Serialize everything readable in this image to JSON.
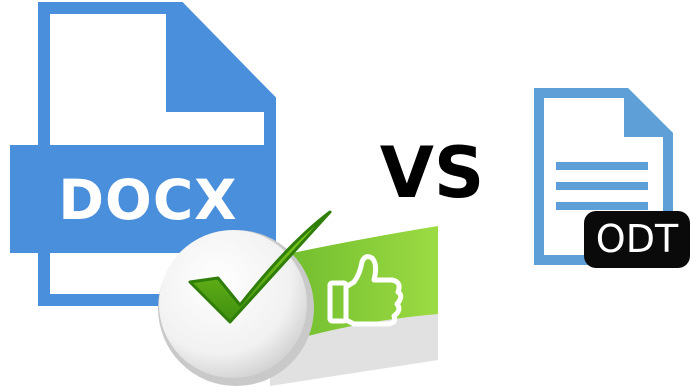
{
  "docx": {
    "label": "DOCX",
    "color": "#4a8fdb"
  },
  "comparison": {
    "label": "VS"
  },
  "odt": {
    "label": "ODT",
    "color": "#5e9fd8",
    "badge_color": "#0a0a0a"
  },
  "badge": {
    "icons": [
      "checkmark-icon",
      "thumbs-up-icon"
    ],
    "check_color": "#6cbf12",
    "ribbon_color": "#8ed23a"
  }
}
